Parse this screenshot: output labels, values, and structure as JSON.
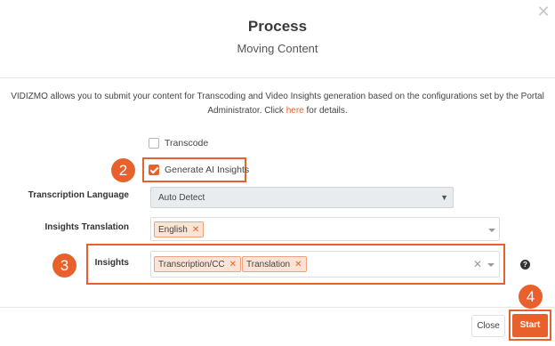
{
  "dialog": {
    "title": "Process",
    "subtitle": "Moving Content",
    "close_icon": "close-icon",
    "info_text_before": "VIDIZMO allows you to submit your content for Transcoding and Video Insights generation based on the configurations set by the Portal Administrator. Click ",
    "info_link": "here",
    "info_text_after": " for details."
  },
  "options": {
    "transcode_label": "Transcode",
    "transcode_checked": false,
    "ai_insights_label": "Generate AI Insights",
    "ai_insights_checked": true
  },
  "fields": {
    "transcription_language_label": "Transcription Language",
    "transcription_language_value": "Auto Detect",
    "insights_translation_label": "Insights Translation",
    "insights_translation_tags": [
      "English"
    ],
    "insights_label": "Insights",
    "insights_tags": [
      "Transcription/CC",
      "Translation"
    ]
  },
  "markers": {
    "step2": "2",
    "step3": "3",
    "step4": "4"
  },
  "footer": {
    "close_label": "Close",
    "start_label": "Start"
  },
  "colors": {
    "accent": "#e8612c"
  }
}
